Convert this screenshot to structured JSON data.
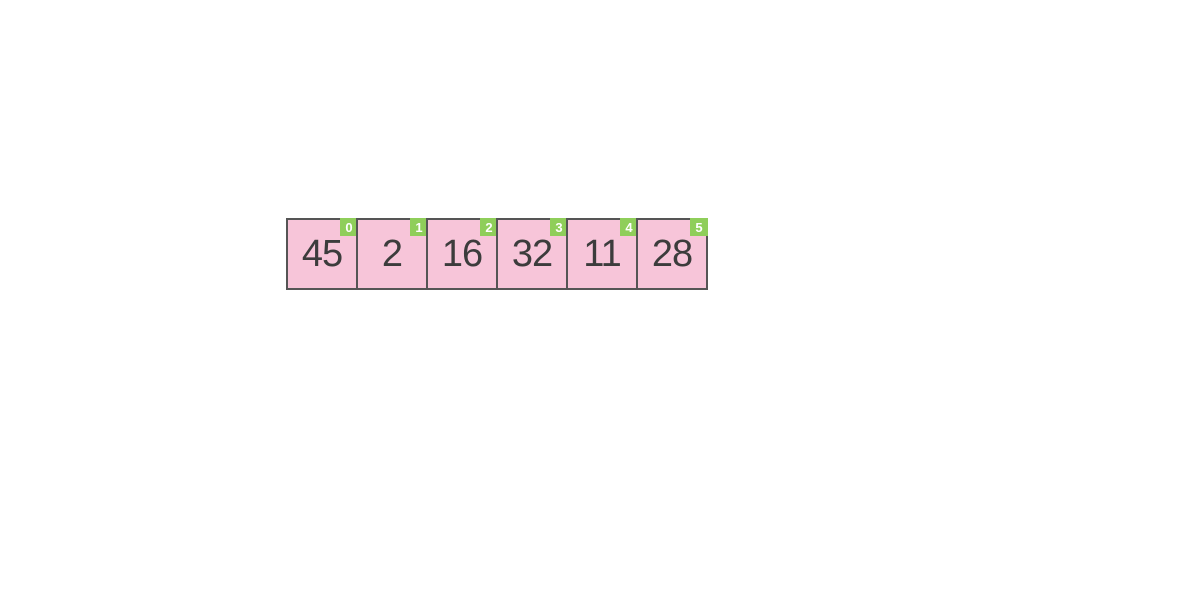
{
  "array": {
    "cells": [
      {
        "index": "0",
        "value": "45"
      },
      {
        "index": "1",
        "value": "2"
      },
      {
        "index": "2",
        "value": "16"
      },
      {
        "index": "3",
        "value": "32"
      },
      {
        "index": "4",
        "value": "11"
      },
      {
        "index": "5",
        "value": "28"
      }
    ]
  },
  "colors": {
    "cell_fill": "#f7c5d9",
    "cell_border": "#555555",
    "index_fill": "#8fce5a",
    "index_text": "#ffffff",
    "value_text": "#3c3c3c"
  }
}
